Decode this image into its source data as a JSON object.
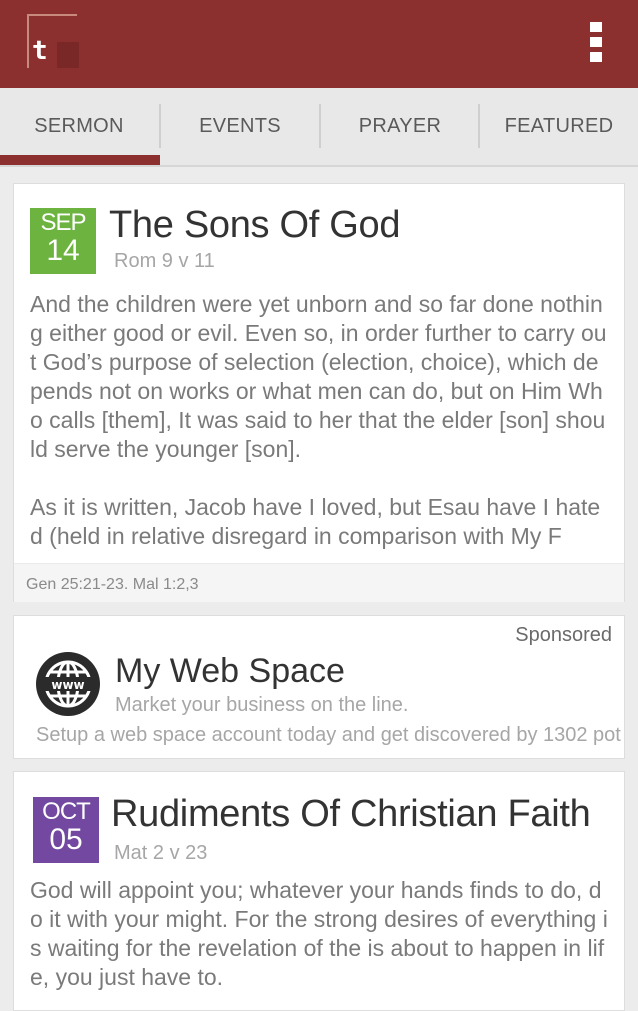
{
  "appbar": {
    "logo_letter": "t",
    "brand_color": "#8b302f"
  },
  "tabs": [
    {
      "label": "SERMON",
      "active": true
    },
    {
      "label": "EVENTS",
      "active": false
    },
    {
      "label": "PRAYER",
      "active": false
    },
    {
      "label": "FEATURED",
      "active": false
    }
  ],
  "sermons": [
    {
      "month": "SEP",
      "day": "14",
      "date_color": "#6cb33f",
      "title": "The Sons Of God",
      "reference": "Rom 9 v 11",
      "paragraphs": [
        "And the children were yet unborn and so far done nothing either good or evil. Even so, in order further to carry out God’s purpose of selection (election, choice), which depends not on works or what men can do, but on Him Who calls [them], It was said to her that the elder [son] should serve the younger [son].",
        "As it is written, Jacob have I loved, but Esau have I hated (held in relative disregard in comparison with My F"
      ],
      "footer": "Gen 25:21-23. Mal 1:2,3"
    },
    {
      "month": "OCT",
      "day": "05",
      "date_color": "#7248a0",
      "title": "Rudiments Of Christian Faith",
      "reference": "Mat 2 v 23",
      "paragraphs": [
        "God will appoint you; whatever your hands finds to do, do it with your might. For the strong desires of everything is waiting for the revelation of the is about to happen in life, you just have to."
      ]
    }
  ],
  "ad": {
    "sponsored_label": "Sponsored",
    "icon": "www-globe-icon",
    "title": "My Web Space",
    "subtitle": "Market your business on the line.",
    "description": "Setup a web space account today and get discovered by 1302 pot"
  }
}
